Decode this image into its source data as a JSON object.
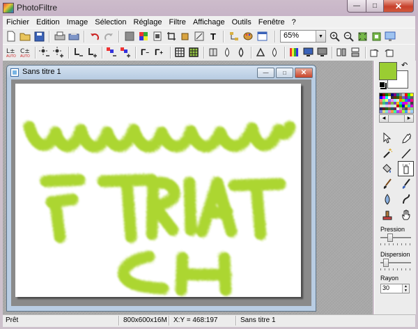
{
  "app": {
    "title": "PhotoFiltre"
  },
  "window_buttons": {
    "minimize": "—",
    "maximize": "□",
    "close": "✕"
  },
  "menu": [
    "Fichier",
    "Edition",
    "Image",
    "Sélection",
    "Réglage",
    "Filtre",
    "Affichage",
    "Outils",
    "Fenêtre",
    "?"
  ],
  "toolbar": {
    "zoom_value": "65%",
    "text_tool_glyph": "T"
  },
  "document": {
    "title": "Sans titre 1"
  },
  "panel": {
    "fg_color": "#9acd32",
    "bg_color": "#ffffff",
    "pression_label": "Pression",
    "dispersion_label": "Dispersion",
    "rayon_label": "Rayon",
    "rayon_value": "30"
  },
  "status": {
    "state": "Prêt",
    "size": "800x600x16M",
    "coords": "X:Y = 468:197",
    "doc": "Sans titre 1"
  },
  "canvas_text": {
    "line1": "wwww",
    "line2": "FTRIATT",
    "line3": "CH"
  },
  "brush_color": "#a6d322"
}
